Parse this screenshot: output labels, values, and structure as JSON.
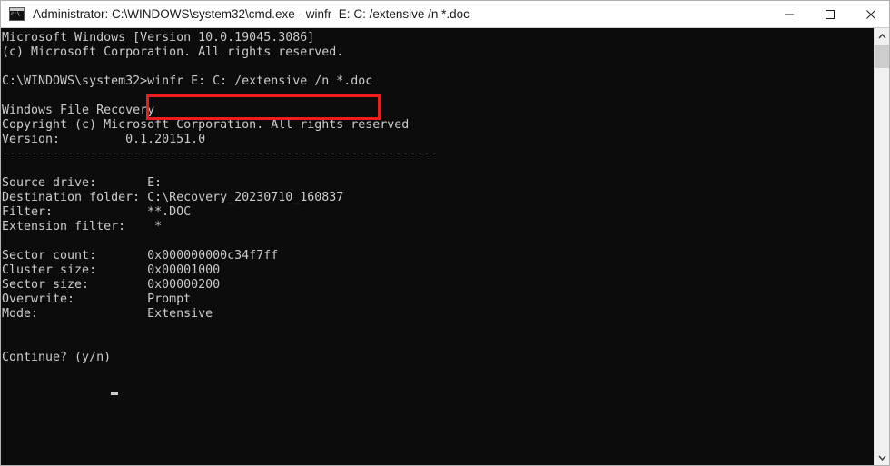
{
  "window": {
    "title": "Administrator: C:\\WINDOWS\\system32\\cmd.exe - winfr  E: C: /extensive /n *.doc",
    "icon": "cmd-console-icon",
    "colors": {
      "titlebar_background": "#ffffff",
      "titlebar_text": "#1a1a1a",
      "console_background": "#0c0c0c",
      "console_text": "#cccccc",
      "highlight_border": "#ee1c1c",
      "scrollbar_track": "#f0f0f0",
      "scrollbar_thumb": "#cdcdcd"
    },
    "controls": {
      "minimize": "Minimize",
      "maximize": "Maximize",
      "close": "Close"
    }
  },
  "console": {
    "output": "Microsoft Windows [Version 10.0.19045.3086]\n(c) Microsoft Corporation. All rights reserved.\n\nC:\\WINDOWS\\system32>winfr E: C: /extensive /n *.doc\n\nWindows File Recovery\nCopyright (c) Microsoft Corporation. All rights reserved\nVersion:         0.1.20151.0\n------------------------------------------------------------\n\nSource drive:       E:\nDestination folder: C:\\Recovery_20230710_160837\nFilter:             **.DOC\nExtension filter:    *\n\nSector count:       0x000000000c34f7ff\nCluster size:       0x00001000\nSector size:        0x00000200\nOverwrite:          Prompt\nMode:               Extensive\n\n\nContinue? (y/n)",
    "lines": [
      "Microsoft Windows [Version 10.0.19045.3086]",
      "(c) Microsoft Corporation. All rights reserved.",
      "",
      "C:\\WINDOWS\\system32>winfr E: C: /extensive /n *.doc",
      "",
      "Windows File Recovery",
      "Copyright (c) Microsoft Corporation. All rights reserved",
      "Version:         0.1.20151.0",
      "------------------------------------------------------------",
      "",
      "Source drive:       E:",
      "Destination folder: C:\\Recovery_20230710_160837",
      "Filter:             **.DOC",
      "Extension filter:    *",
      "",
      "Sector count:       0x000000000c34f7ff",
      "Cluster size:       0x00001000",
      "Sector size:        0x00000200",
      "Overwrite:          Prompt",
      "Mode:               Extensive",
      "",
      "",
      "Continue? (y/n)"
    ],
    "prompt_path": "C:\\WINDOWS\\system32>",
    "command": "winfr E: C: /extensive /n *.doc",
    "program": {
      "name": "Windows File Recovery",
      "copyright": "Copyright (c) Microsoft Corporation. All rights reserved",
      "version_label": "Version:",
      "version_value": "0.1.20151.0"
    },
    "parameters": [
      {
        "label": "Source drive:",
        "value": "E:"
      },
      {
        "label": "Destination folder:",
        "value": "C:\\Recovery_20230710_160837"
      },
      {
        "label": "Filter:",
        "value": "**.DOC"
      },
      {
        "label": "Extension filter:",
        "value": "*"
      },
      {
        "label": "Sector count:",
        "value": "0x000000000c34f7ff"
      },
      {
        "label": "Cluster size:",
        "value": "0x00001000"
      },
      {
        "label": "Sector size:",
        "value": "0x00000200"
      },
      {
        "label": "Overwrite:",
        "value": "Prompt"
      },
      {
        "label": "Mode:",
        "value": "Extensive"
      }
    ],
    "os_banner": "Microsoft Windows [Version 10.0.19045.3086]",
    "os_copyright": "(c) Microsoft Corporation. All rights reserved.",
    "confirm_prompt": "Continue? (y/n)"
  },
  "annotation": {
    "type": "rectangle-highlight",
    "target_text": "winfr E: C: /extensive /n *.doc"
  },
  "scrollbar": {
    "up_arrow": "▲",
    "down_arrow": "▼"
  }
}
